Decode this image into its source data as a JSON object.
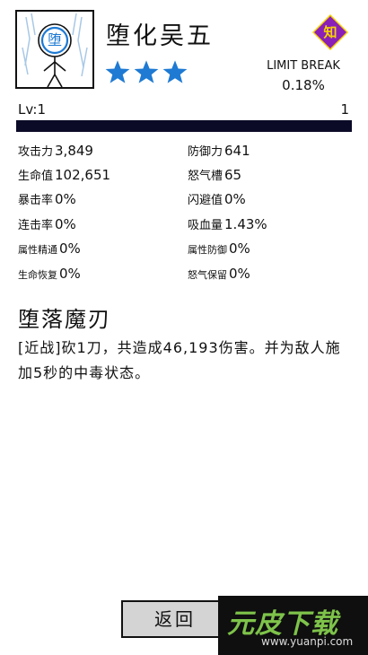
{
  "character": {
    "portrait_char": "堕",
    "name": "堕化吴五",
    "stars": 3,
    "class_badge": "知",
    "colors": {
      "star": "#1e7ad3",
      "badge_bg": "#8a20b8",
      "badge_text": "#f6d400",
      "level_bar": "#0b0b28"
    }
  },
  "limit_break": {
    "label": "LIMIT BREAK",
    "value": "0.18%"
  },
  "level": {
    "label": "Lv:1",
    "right_value": "1",
    "progress_fraction": 1.0
  },
  "stats": [
    {
      "label": "攻击力",
      "value": "3,849"
    },
    {
      "label": "防御力",
      "value": "641"
    },
    {
      "label": "生命值",
      "value": "102,651"
    },
    {
      "label": "怒气槽",
      "value": "65"
    },
    {
      "label": "暴击率",
      "value": "0%"
    },
    {
      "label": "闪避值",
      "value": "0%"
    },
    {
      "label": "连击率",
      "value": "0%"
    },
    {
      "label": "吸血量",
      "value": "1.43%"
    },
    {
      "label": "属性精通",
      "value": "0%"
    },
    {
      "label": "属性防御",
      "value": "0%"
    },
    {
      "label": "生命恢复",
      "value": "0%"
    },
    {
      "label": "怒气保留",
      "value": "0%"
    }
  ],
  "skill": {
    "name": "堕落魔刃",
    "description": "[近战]砍1刀，共造成46,193伤害。并为敌人施加5秒的中毒状态。"
  },
  "back_button": {
    "label": "返回"
  },
  "watermark": {
    "text": "元皮下载",
    "url": "www.yuanpi.com"
  }
}
